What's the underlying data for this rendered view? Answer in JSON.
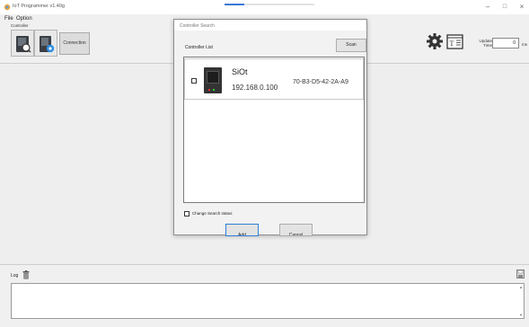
{
  "window": {
    "title": "IoT Programmer v1.40g",
    "minimize": "–",
    "maximize": "□",
    "close": "×",
    "loading_progress": 0.22
  },
  "menu": {
    "items": [
      "File",
      "Option"
    ]
  },
  "toolbar": {
    "controller_group_label": "Controller",
    "connection_label": "Connection",
    "update_time_label": "Update Time",
    "update_time_value": "0",
    "update_time_unit": "ms"
  },
  "dialog": {
    "title": "Controller Search",
    "list_label": "Controller List",
    "scan_label": "Scan",
    "controllers": [
      {
        "name": "SiOt",
        "ip": "192.168.0.100",
        "mac": "70-B3-D5-42-2A-A9",
        "checked": false
      }
    ],
    "change_status_label": "Change Search status",
    "add_label": "Add",
    "cancel_label": "Cancel"
  },
  "log": {
    "label": "Log"
  },
  "colors": {
    "accent": "#2f7fd8",
    "progress": "#3a78d8"
  }
}
